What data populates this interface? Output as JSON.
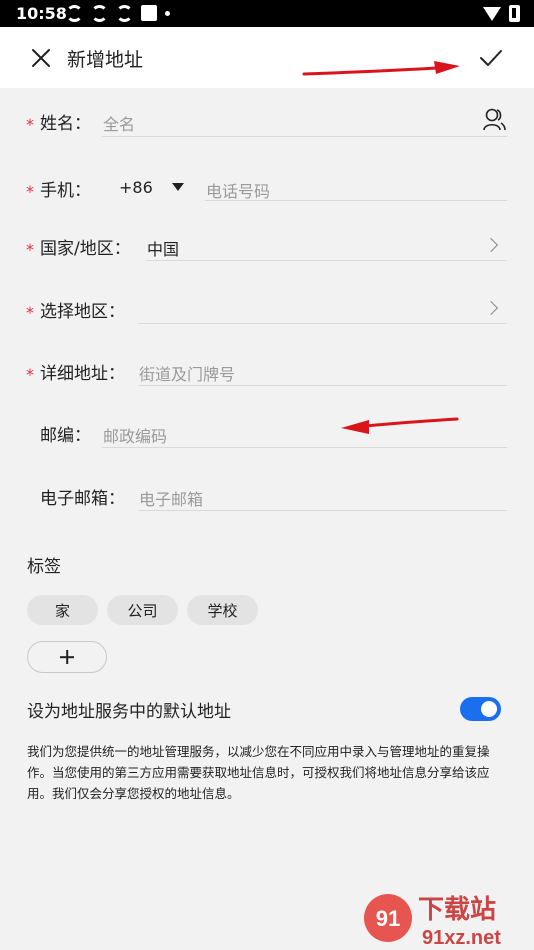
{
  "status_bar": {
    "time": "10:58"
  },
  "header": {
    "title": "新增地址"
  },
  "form": {
    "name": {
      "label": "姓名：",
      "placeholder": "全名",
      "required_mark": "*"
    },
    "phone": {
      "label": "手机：",
      "country_code": "+86",
      "placeholder": "电话号码",
      "required_mark": "*"
    },
    "country": {
      "label": "国家/地区：",
      "value": "中国",
      "required_mark": "*"
    },
    "region": {
      "label": "选择地区：",
      "required_mark": "*"
    },
    "address": {
      "label": "详细地址：",
      "placeholder": "街道及门牌号",
      "required_mark": "*"
    },
    "postcode": {
      "label": "邮编：",
      "placeholder": "邮政编码"
    },
    "email": {
      "label": "电子邮箱：",
      "placeholder": "电子邮箱"
    }
  },
  "tags": {
    "title": "标签",
    "items": [
      "家",
      "公司",
      "学校"
    ]
  },
  "default_address": {
    "label": "设为地址服务中的默认地址",
    "enabled": true
  },
  "description": "我们为您提供统一的地址管理服务，以减少您在不同应用中录入与管理地址的重复操作。当您使用的第三方应用需要获取地址信息时，可授权我们将地址信息分享给该应用。我们仅会分享您授权的地址信息。",
  "watermark": {
    "site": "91xz.net",
    "name": "下载站"
  },
  "colors": {
    "accent": "#1a6ff0",
    "required": "#e1333b",
    "annotation": "#d9141b"
  }
}
